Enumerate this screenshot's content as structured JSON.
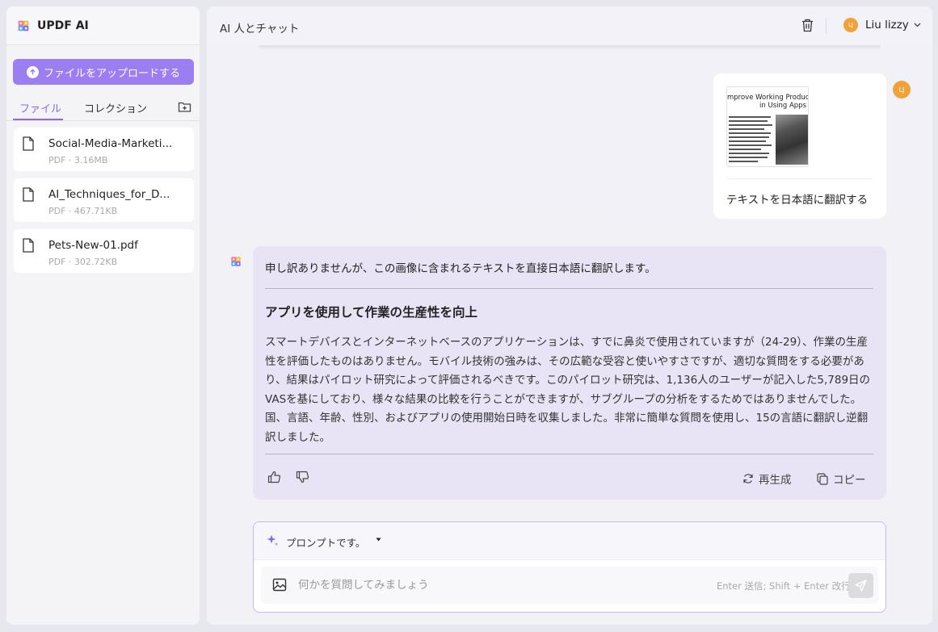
{
  "app": {
    "name": "UPDF AI"
  },
  "sidebar": {
    "upload_label": "ファイルをアップロードする",
    "tabs": [
      {
        "label": "ファイル",
        "active": true
      },
      {
        "label": "コレクション",
        "active": false
      }
    ],
    "files": [
      {
        "name": "Social-Media-Marketi...",
        "meta": "PDF · 3.16MB"
      },
      {
        "name": "AI_Techniques_for_D...",
        "meta": "PDF · 467.71KB"
      },
      {
        "name": "Pets-New-01.pdf",
        "meta": "PDF · 302.72KB"
      }
    ]
  },
  "header": {
    "title": "AI 人とチャット",
    "user_name": "Liu lizzy",
    "user_initials": "LJ"
  },
  "chat": {
    "user_message": {
      "avatar_initials": "LJ",
      "thumbnail_title_1": "mprove Working Productio",
      "thumbnail_title_2": "in Using Apps",
      "text": "テキストを日本語に翻訳する"
    },
    "ai_message": {
      "intro": "申し訳ありませんが、この画像に含まれるテキストを直接日本語に翻訳します。",
      "heading": "アプリを使用して作業の生産性を向上",
      "body": "スマートデバイスとインターネットベースのアプリケーションは、すでに鼻炎で使用されていますが（24-29）、作業の生産性を評価したものはありません。モバイル技術の強みは、その広範な受容と使いやすさですが、適切な質問をする必要があり、結果はパイロット研究によって評価されるべきです。このパイロット研究は、1,136人のユーザーが記入した5,789日のVASを基にしており、様々な結果の比較を行うことができますが、サブグループの分析をするためではありませんでした。国、言語、年齢、性別、およびアプリの使用開始日時を収集しました。非常に簡単な質問を使用し、15の言語に翻訳し逆翻訳しました。",
      "regenerate_label": "再生成",
      "copy_label": "コピー"
    }
  },
  "composer": {
    "prompt_label": "プロンプトです。",
    "placeholder": "何かを質問してみましょう",
    "hint": "Enter 送信; Shift + Enter 改行"
  },
  "colors": {
    "accent": "#9b7ff2",
    "avatar": "#f0a23a",
    "ai_bubble": "#e8e4f6"
  }
}
